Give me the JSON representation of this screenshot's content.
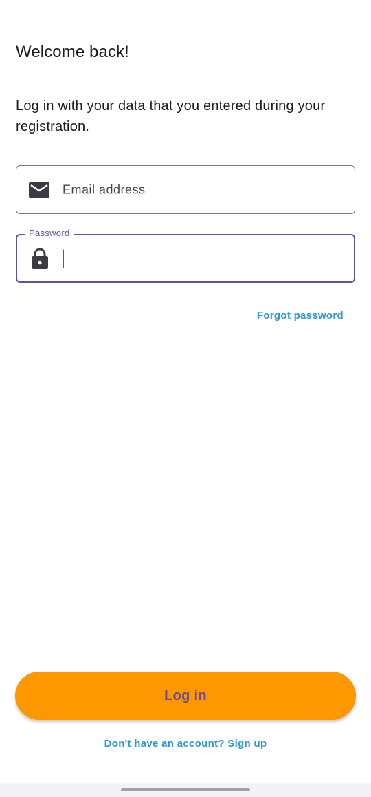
{
  "header": {
    "title": "Welcome back!",
    "subtitle": "Log in with your data that you entered during your registration."
  },
  "form": {
    "email": {
      "placeholder": "Email address",
      "value": "",
      "icon": "mail-icon"
    },
    "password": {
      "label": "Password",
      "value": "",
      "icon": "lock-icon",
      "focused": true
    },
    "forgot_password": "Forgot password"
  },
  "actions": {
    "login_label": "Log in",
    "signup_label": "Don't have an account? Sign up"
  },
  "colors": {
    "primary": "#6750a4",
    "button": "#ff9800",
    "button_text": "#6a4a8c",
    "link": "#2e97d4",
    "outline": "#79747e",
    "icon": "#3c3b42"
  }
}
